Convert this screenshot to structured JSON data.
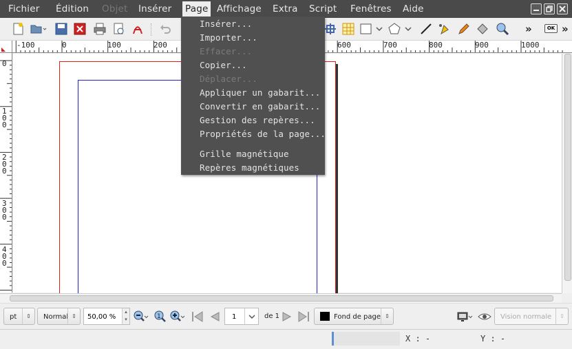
{
  "menubar": {
    "items": [
      {
        "label": "Fichier",
        "disabled": false
      },
      {
        "label": "Édition",
        "disabled": false
      },
      {
        "label": "Objet",
        "disabled": true
      },
      {
        "label": "Insérer",
        "disabled": false
      },
      {
        "label": "Page",
        "disabled": false,
        "active": true
      },
      {
        "label": "Affichage",
        "disabled": false
      },
      {
        "label": "Extra",
        "disabled": false
      },
      {
        "label": "Script",
        "disabled": false
      },
      {
        "label": "Fenêtres",
        "disabled": false
      },
      {
        "label": "Aide",
        "disabled": false
      }
    ]
  },
  "page_menu": {
    "items": [
      {
        "label": "Insérer...",
        "disabled": false
      },
      {
        "label": "Importer...",
        "disabled": false
      },
      {
        "label": "Effacer...",
        "disabled": true
      },
      {
        "label": "Copier...",
        "disabled": false
      },
      {
        "label": "Déplacer...",
        "disabled": true
      },
      {
        "label": "Appliquer un gabarit...",
        "disabled": false
      },
      {
        "label": "Convertir en gabarit...",
        "disabled": false
      },
      {
        "label": "Gestion des repères...",
        "disabled": false
      },
      {
        "label": "Propriétés de la page...",
        "disabled": false
      },
      {
        "label": "Grille magnétique",
        "disabled": false
      },
      {
        "label": "Repères magnétiques",
        "disabled": false
      }
    ]
  },
  "toolbar": {
    "overflow_label": "»",
    "ok_label": "OK"
  },
  "ruler": {
    "h_labels": [
      "-100",
      "0",
      "100",
      "200",
      "600",
      "700",
      "800",
      "900",
      "1000"
    ],
    "v_labels": [
      "0",
      "100",
      "200",
      "300",
      "400"
    ]
  },
  "bottombar": {
    "unit": "pt",
    "quality": "Normal",
    "zoom": "50,00 %",
    "page_number": "1",
    "page_of": "de 1",
    "layer": "Fond de page",
    "view_mode": "Vision normale"
  },
  "statusbar": {
    "x_label": "X : -",
    "y_label": "Y : -"
  },
  "colors": {
    "menubar_bg": "#4a4a4a",
    "page_border": "#dd2211",
    "margin_border": "#2222cc"
  }
}
